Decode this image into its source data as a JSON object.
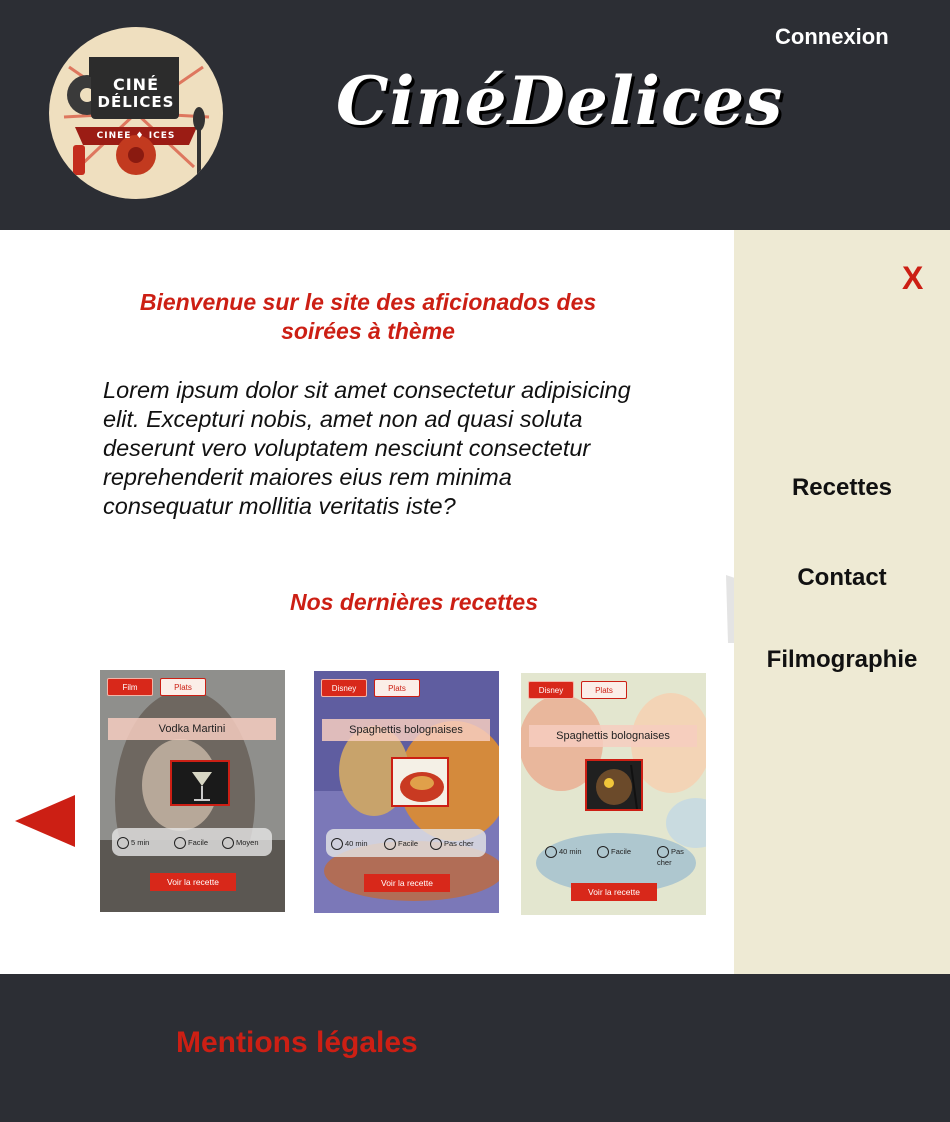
{
  "header": {
    "logo_alt": "CinéDélices logo",
    "logo_line1": "CINÉ",
    "logo_line2": "DÉLICES",
    "logo_band": "CINEE ♦ ICES",
    "login_label": "Connexion",
    "site_title": "CinéDelices"
  },
  "main": {
    "welcome": "Bienvenue sur le site des aficionados des soirées à thème",
    "intro": "Lorem ipsum dolor sit amet consectetur adipisicing elit. Excepturi nobis, amet non ad quasi soluta deserunt vero voluptatem nesciunt consectetur reprehenderit maiores eius rem minima consequatur mollitia veritatis iste?",
    "latest_title": "Nos dernières recettes",
    "recipes": [
      {
        "tag1": "Film",
        "tag2": "Plats",
        "title": "Vodka Martini",
        "time": "5 min",
        "difficulty": "Facile",
        "price": "Moyen",
        "button": "Voir la recette"
      },
      {
        "tag1": "Disney",
        "tag2": "Plats",
        "title": "Spaghettis bolognaises",
        "time": "40 min",
        "difficulty": "Facile",
        "price": "Pas cher",
        "button": "Voir la recette"
      },
      {
        "tag1": "Disney",
        "tag2": "Plats",
        "title": "Spaghettis bolognaises",
        "time": "40 min",
        "difficulty": "Facile",
        "price": "Pas cher",
        "button": "Voir la recette"
      }
    ]
  },
  "sidebar": {
    "close_label": "X",
    "items": [
      {
        "label": "Recettes"
      },
      {
        "label": "Contact"
      },
      {
        "label": "Filmographie"
      }
    ]
  },
  "footer": {
    "legal_label": "Mentions légales"
  },
  "colors": {
    "accent": "#cc1f14",
    "dark": "#2c2e34",
    "sidebar_bg": "#eeead4"
  }
}
